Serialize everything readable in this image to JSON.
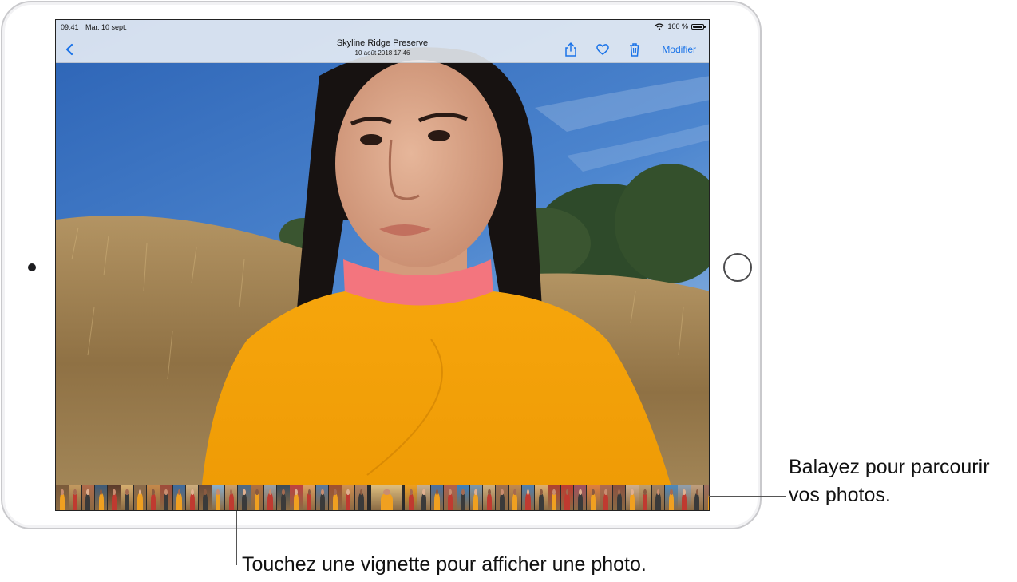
{
  "status_bar": {
    "time": "09:41",
    "date": "Mar. 10 sept.",
    "battery": "100 %"
  },
  "nav_bar": {
    "title": "Skyline Ridge Preserve",
    "subtitle": "10 août 2018 17:46",
    "modify_label": "Modifier",
    "accent_color": "#1a73e8"
  },
  "icons": {
    "back": "chevron-left-icon",
    "share": "share-icon",
    "favorite": "heart-icon",
    "delete": "trash-icon"
  },
  "thumbnails": {
    "colors": [
      "#7a5a3a",
      "#c59b60",
      "#b06a4a",
      "#3b5a7a",
      "#5a3a2a",
      "#d8b070",
      "#8a6a4a",
      "#c78a4a",
      "#a04a3a",
      "#3a6aa0",
      "#d0b080",
      "#6a4a3a",
      "#8ab0d0",
      "#c9a070",
      "#4a6a8a",
      "#b07040",
      "#9aa0a8",
      "#3a4a5a",
      "#c04040",
      "#e0a060",
      "#5a7aa0",
      "#a05030",
      "#d09050",
      "#b08060",
      "#e0c080",
      "#f0a020",
      "#c9b090",
      "#4a70a0",
      "#b06050",
      "#3a80c0",
      "#7a98b0",
      "#d0b080",
      "#a07050",
      "#c08a50",
      "#5080b0",
      "#e0b070",
      "#b04030",
      "#c03a30",
      "#a05060",
      "#e08040",
      "#b06a50",
      "#8a5040",
      "#d0b090",
      "#c0a070",
      "#a08060",
      "#4a8ac0",
      "#90a0b0",
      "#c0a080",
      "#a07060",
      "#6a7a90"
    ],
    "selected_index": 24
  },
  "callouts": {
    "swipe": "Balayez pour parcourir vos photos.",
    "tap": "Touchez une vignette pour afficher une photo."
  }
}
